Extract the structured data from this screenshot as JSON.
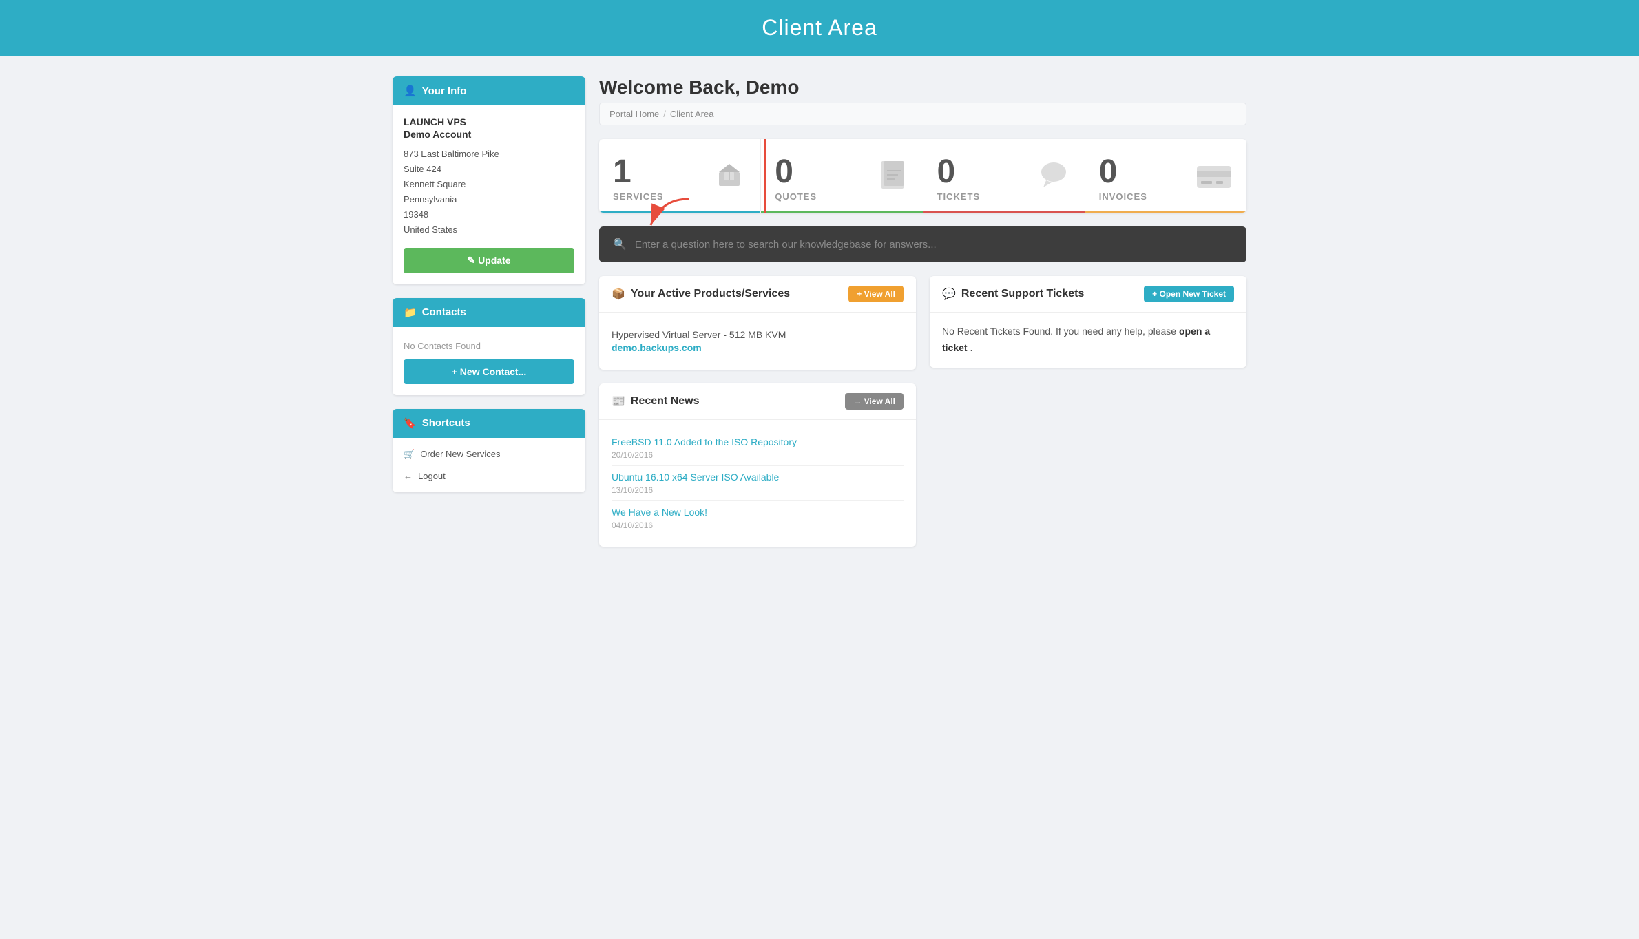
{
  "header": {
    "title": "Client Area"
  },
  "sidebar": {
    "your_info": {
      "header": "Your Info",
      "company": "LAUNCH VPS",
      "account": "Demo Account",
      "address_line1": "873 East Baltimore Pike",
      "address_line2": "Suite 424",
      "address_line3": "Kennett Square",
      "address_line4": "Pennsylvania",
      "address_line5": "19348",
      "address_line6": "United States",
      "update_label": "✎ Update"
    },
    "contacts": {
      "header": "Contacts",
      "no_contacts": "No Contacts Found",
      "new_contact_label": "+ New Contact..."
    },
    "shortcuts": {
      "header": "Shortcuts",
      "items": [
        {
          "icon": "🛒",
          "label": "Order New Services"
        },
        {
          "icon": "←",
          "label": "Logout"
        }
      ]
    }
  },
  "main": {
    "welcome": "Welcome Back, Demo",
    "breadcrumb": {
      "portal_home": "Portal Home",
      "separator": "/",
      "client_area": "Client Area"
    },
    "stats": [
      {
        "number": "1",
        "label": "SERVICES",
        "type": "services"
      },
      {
        "number": "0",
        "label": "QUOTES",
        "type": "quotes"
      },
      {
        "number": "0",
        "label": "TICKETS",
        "type": "tickets"
      },
      {
        "number": "0",
        "label": "INVOICES",
        "type": "invoices"
      }
    ],
    "search": {
      "placeholder": "Enter a question here to search our knowledgebase for answers..."
    },
    "active_services": {
      "title": "Your Active Products/Services",
      "view_all_label": "+ View All",
      "service_name": "Hypervised Virtual Server - 512 MB KVM",
      "service_domain": "demo.backups.com"
    },
    "recent_news": {
      "title": "Recent News",
      "view_all_label": "→ View All",
      "items": [
        {
          "title": "FreeBSD 11.0 Added to the ISO Repository",
          "date": "20/10/2016"
        },
        {
          "title": "Ubuntu 16.10 x64 Server ISO Available",
          "date": "13/10/2016"
        },
        {
          "title": "We Have a New Look!",
          "date": "04/10/2016"
        }
      ]
    },
    "support_tickets": {
      "title": "Recent Support Tickets",
      "open_new_label": "+ Open New Ticket",
      "no_tickets_text": "No Recent Tickets Found. If you need any help, please ",
      "open_ticket_link": "open a ticket",
      "no_tickets_suffix": "."
    }
  }
}
